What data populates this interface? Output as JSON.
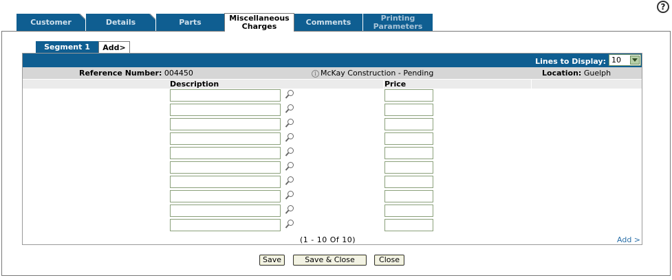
{
  "help_icon": "?",
  "tabs": [
    {
      "label": "Customer"
    },
    {
      "label": "Details"
    },
    {
      "label": "Parts"
    },
    {
      "label": "Miscellaneous Charges"
    },
    {
      "label": "Comments"
    },
    {
      "label": "Printing Parameters"
    }
  ],
  "segment_tabs": {
    "active": "Segment 1",
    "add": "Add>"
  },
  "lines_to_display": {
    "label": "Lines to Display:",
    "value": "10"
  },
  "info": {
    "reference_label": "Reference Number:",
    "reference_value": "004450",
    "customer": "McKay Construction",
    "separator": " - ",
    "status": "Pending",
    "location_label": "Location:",
    "location_value": "Guelph"
  },
  "columns": {
    "description": "Description",
    "price": "Price"
  },
  "rows": [
    {
      "description": "",
      "price": ""
    },
    {
      "description": "",
      "price": ""
    },
    {
      "description": "",
      "price": ""
    },
    {
      "description": "",
      "price": ""
    },
    {
      "description": "",
      "price": ""
    },
    {
      "description": "",
      "price": ""
    },
    {
      "description": "",
      "price": ""
    },
    {
      "description": "",
      "price": ""
    },
    {
      "description": "",
      "price": ""
    },
    {
      "description": "",
      "price": ""
    }
  ],
  "pager": "(1 - 10 Of 10)",
  "add_link": "Add >",
  "buttons": {
    "save": "Save",
    "save_close": "Save & Close",
    "close": "Close"
  },
  "icons": {
    "help": "help-icon",
    "info": "info-icon",
    "lookup": "magnifier-icon",
    "dropdown": "chevron-down-icon"
  },
  "colors": {
    "tab_blue": "#0f5e91",
    "info_bar": "#d6d6d6",
    "link": "#2a6fa8"
  }
}
